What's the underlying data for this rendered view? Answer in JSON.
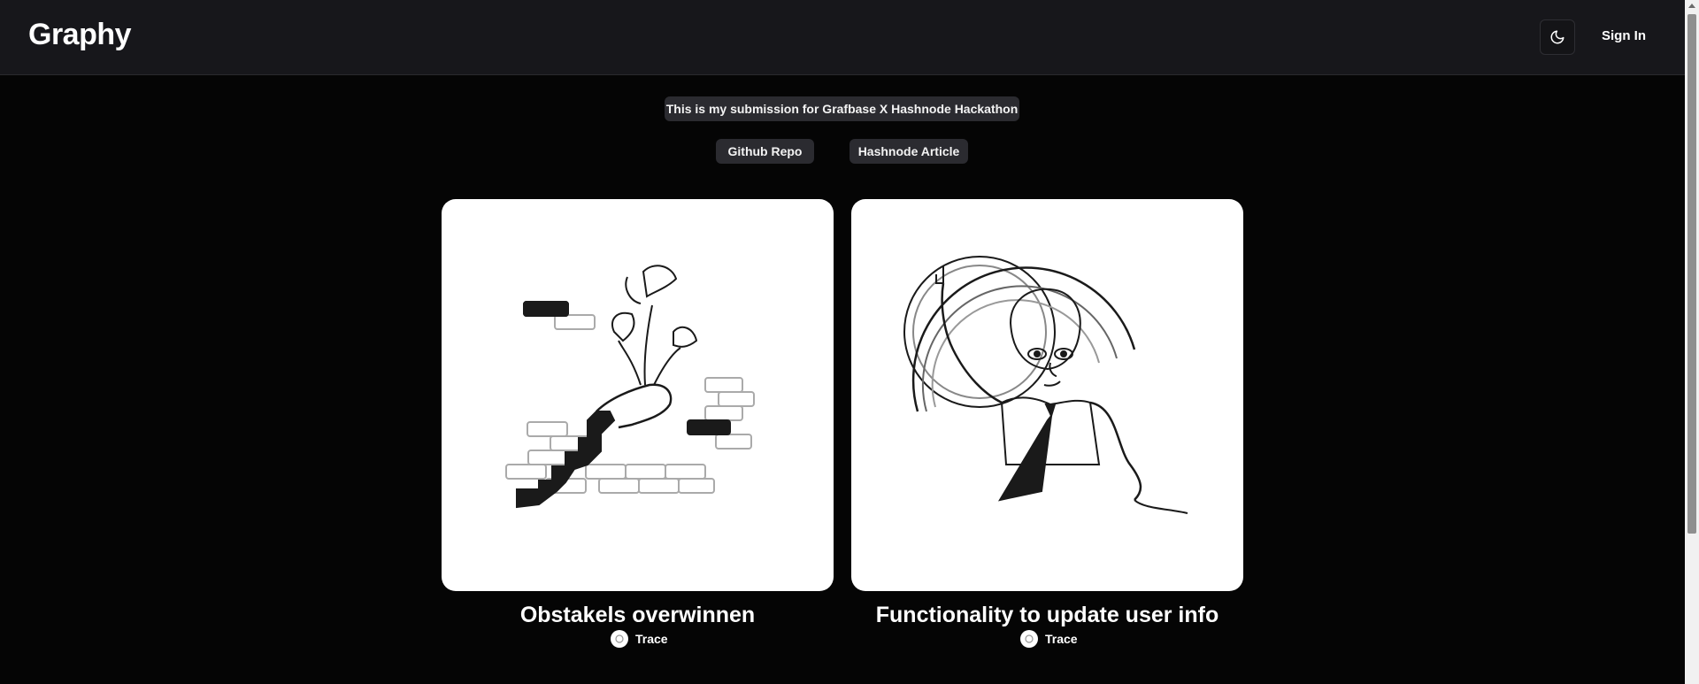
{
  "app": {
    "name": "Graphy"
  },
  "header": {
    "theme_toggle_icon": "moon-icon",
    "sign_in_label": "Sign In"
  },
  "banner": {
    "submission_text": "This is my submission for  Grafbase X Hashnode Hackathon",
    "github_label": "Github Repo",
    "article_label": "Hashnode Article"
  },
  "posts": [
    {
      "title": "Obstakels overwinnen",
      "author": "Trace",
      "image_icon": "hand-flowers-brick-wall-illustration"
    },
    {
      "title": "Functionality to update user info",
      "author": "Trace",
      "image_icon": "man-in-circle-illustration"
    }
  ],
  "colors": {
    "background": "#050505",
    "header": "#17171b",
    "pill": "#2b2b30",
    "text": "#ffffff"
  }
}
